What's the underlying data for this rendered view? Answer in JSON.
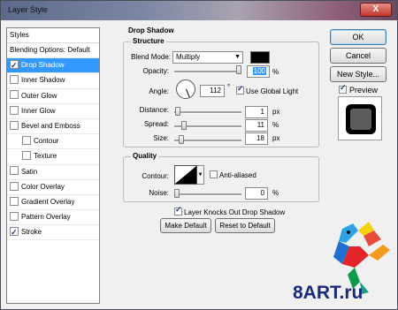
{
  "window": {
    "title": "Layer Style",
    "close_label": "X"
  },
  "styles_list": {
    "header": "Styles",
    "items": [
      {
        "label": "Blending Options: Default",
        "checkbox": false,
        "checked": false,
        "selected": false,
        "indent": false
      },
      {
        "label": "Drop Shadow",
        "checkbox": true,
        "checked": true,
        "selected": true,
        "indent": false
      },
      {
        "label": "Inner Shadow",
        "checkbox": true,
        "checked": false,
        "selected": false,
        "indent": false
      },
      {
        "label": "Outer Glow",
        "checkbox": true,
        "checked": false,
        "selected": false,
        "indent": false
      },
      {
        "label": "Inner Glow",
        "checkbox": true,
        "checked": false,
        "selected": false,
        "indent": false
      },
      {
        "label": "Bevel and Emboss",
        "checkbox": true,
        "checked": false,
        "selected": false,
        "indent": false
      },
      {
        "label": "Contour",
        "checkbox": true,
        "checked": false,
        "selected": false,
        "indent": true
      },
      {
        "label": "Texture",
        "checkbox": true,
        "checked": false,
        "selected": false,
        "indent": true
      },
      {
        "label": "Satin",
        "checkbox": true,
        "checked": false,
        "selected": false,
        "indent": false
      },
      {
        "label": "Color Overlay",
        "checkbox": true,
        "checked": false,
        "selected": false,
        "indent": false
      },
      {
        "label": "Gradient Overlay",
        "checkbox": true,
        "checked": false,
        "selected": false,
        "indent": false
      },
      {
        "label": "Pattern Overlay",
        "checkbox": true,
        "checked": false,
        "selected": false,
        "indent": false
      },
      {
        "label": "Stroke",
        "checkbox": true,
        "checked": true,
        "selected": false,
        "indent": false
      }
    ]
  },
  "drop_shadow": {
    "title": "Drop Shadow",
    "structure": {
      "title": "Structure",
      "blend_mode_label": "Blend Mode:",
      "blend_mode_value": "Multiply",
      "shadow_color": "#000000",
      "opacity_label": "Opacity:",
      "opacity_value": "100",
      "opacity_unit": "%",
      "opacity_level": 1.0,
      "angle_label": "Angle:",
      "angle_value": "112",
      "angle_unit": "°",
      "use_global_light_label": "Use Global Light",
      "use_global_light": true,
      "distance_label": "Distance:",
      "distance_value": "1",
      "distance_unit": "px",
      "distance_level": 0.01,
      "spread_label": "Spread:",
      "spread_value": "11",
      "spread_unit": "%",
      "spread_level": 0.11,
      "size_label": "Size:",
      "size_value": "18",
      "size_unit": "px",
      "size_level": 0.072
    },
    "quality": {
      "title": "Quality",
      "contour_label": "Contour:",
      "anti_aliased_label": "Anti-aliased",
      "anti_aliased": false,
      "noise_label": "Noise:",
      "noise_value": "0",
      "noise_unit": "%",
      "noise_level": 0.0
    },
    "knockout_label": "Layer Knocks Out Drop Shadow",
    "knockout": true,
    "make_default_label": "Make Default",
    "reset_default_label": "Reset to Default"
  },
  "actions": {
    "ok_label": "OK",
    "cancel_label": "Cancel",
    "new_style_label": "New Style...",
    "preview_label": "Preview",
    "preview_checked": true
  },
  "watermark": {
    "text": "8ART.ru"
  }
}
